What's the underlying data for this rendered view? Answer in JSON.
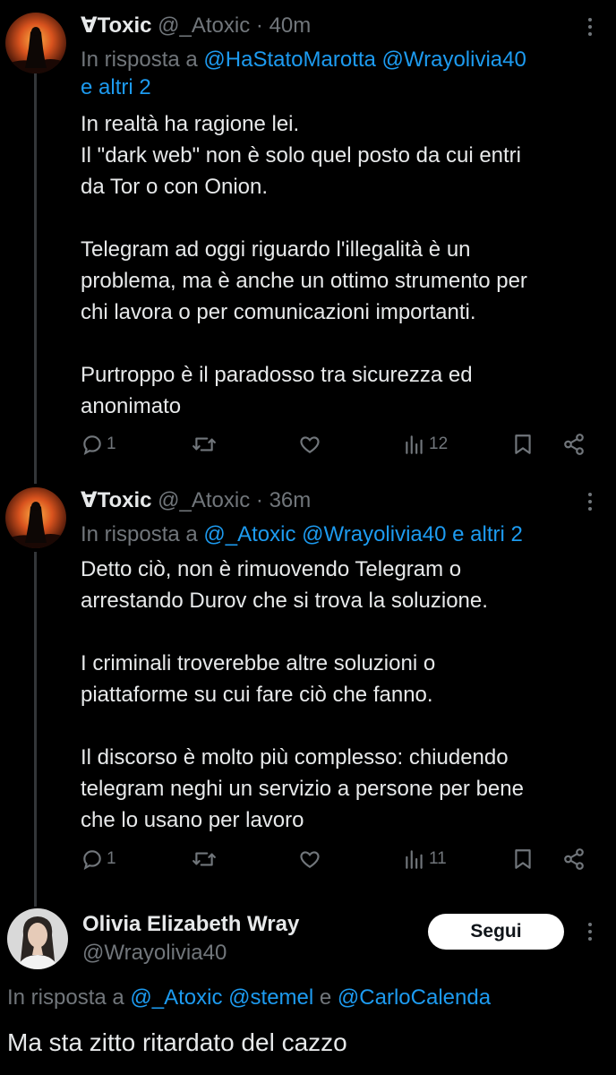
{
  "tweets": [
    {
      "name": "∀Toxic",
      "handle": "@_Atoxic",
      "time": "· 40m",
      "reply_prefix": "In risposta a",
      "reply_line1": "@HaStatoMarotta @Wrayolivia40",
      "reply_line2": "e altri 2",
      "paragraphs": [
        [
          "In realtà ha ragione lei.",
          "Il \"dark web\" non è solo quel posto da cui entri",
          "da Tor o con Onion."
        ],
        [
          "Telegram ad oggi riguardo l'illegalità è un",
          "problema, ma è anche un ottimo strumento per",
          "chi lavora o per comunicazioni importanti."
        ],
        [
          "Purtroppo è il paradosso tra sicurezza ed",
          "anonimato"
        ]
      ],
      "replies": "1",
      "reposts": "",
      "likes": "",
      "views": "12"
    },
    {
      "name": "∀Toxic",
      "handle": "@_Atoxic",
      "time": "· 36m",
      "reply_prefix": "In risposta a",
      "reply_line1": "@_Atoxic @Wrayolivia40 e altri 2",
      "paragraphs": [
        [
          "Detto ciò, non è rimuovendo Telegram o",
          "arrestando Durov che si trova la soluzione."
        ],
        [
          "I criminali troverebbe altre soluzioni o",
          "piattaforme su cui fare ciò che fanno."
        ],
        [
          "Il discorso è molto più complesso: chiudendo",
          "telegram neghi un servizio a persone per bene",
          "che lo usano per lavoro"
        ]
      ],
      "replies": "1",
      "reposts": "",
      "likes": "",
      "views": "11"
    }
  ],
  "focused": {
    "name": "Olivia Elizabeth Wray",
    "handle": "@Wrayolivia40",
    "follow_label": "Segui",
    "reply_prefix": "In risposta a",
    "reply_mention1": "@_Atoxic",
    "reply_mention2": "@stemel",
    "reply_conj": "e",
    "reply_mention3": "@CarloCalenda",
    "text": "Ma sta zitto ritardato del cazzo"
  },
  "icons": {
    "reply": "reply-icon",
    "repost": "repost-icon",
    "like": "heart-icon",
    "views": "analytics-icon",
    "bookmark": "bookmark-icon",
    "share": "share-icon",
    "more": "more-dots-icon"
  },
  "colors": {
    "background": "#000000",
    "text": "#e7e9ea",
    "muted": "#71767b",
    "link": "#1d9bf0",
    "thread_line": "#333639"
  }
}
